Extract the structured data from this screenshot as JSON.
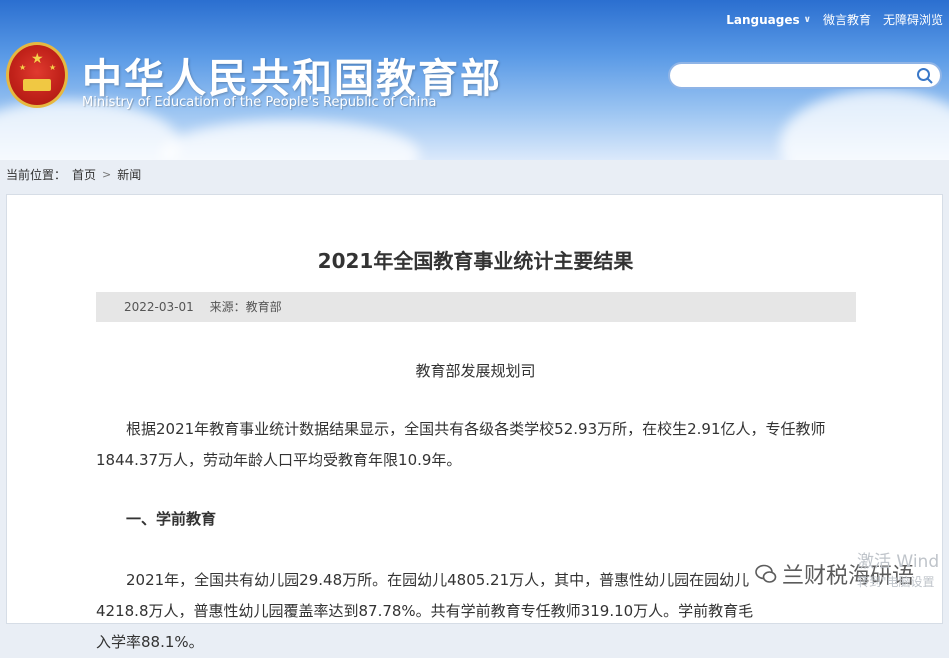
{
  "header": {
    "title_cn": "中华人民共和国教育部",
    "title_en": "Ministry of Education of the People's Republic of China",
    "links": {
      "languages": "Languages",
      "weiyan": "微言教育",
      "accessibility": "无障碍浏览"
    },
    "search": {
      "placeholder": ""
    }
  },
  "breadcrumb": {
    "label": "当前位置：",
    "home": "首页",
    "separator": ">",
    "current": "新闻"
  },
  "article": {
    "title": "2021年全国教育事业统计主要结果",
    "date": "2022-03-01",
    "source": "来源：教育部",
    "department": "教育部发展规划司",
    "paragraph1": "根据2021年教育事业统计数据结果显示，全国共有各级各类学校52.93万所，在校生2.91亿人，专任教师1844.37万人，劳动年龄人口平均受教育年限10.9年。",
    "section1_title": "一、学前教育",
    "paragraph2": "2021年，全国共有幼儿园29.48万所。在园幼儿4805.21万人，其中，普惠性幼儿园在园幼儿4218.8万人，普惠性幼儿园覆盖率达到87.78%。共有学前教育专任教师319.10万人。学前教育毛入学率88.1%。"
  },
  "overlay": {
    "watermark": "兰财税海研语",
    "activate_line1": "激活 Wind",
    "activate_line2": "转到\"电脑设置"
  },
  "colors": {
    "header_blue": "#2b6fd0",
    "meta_bg": "#e6e6e6",
    "text": "#333333"
  }
}
